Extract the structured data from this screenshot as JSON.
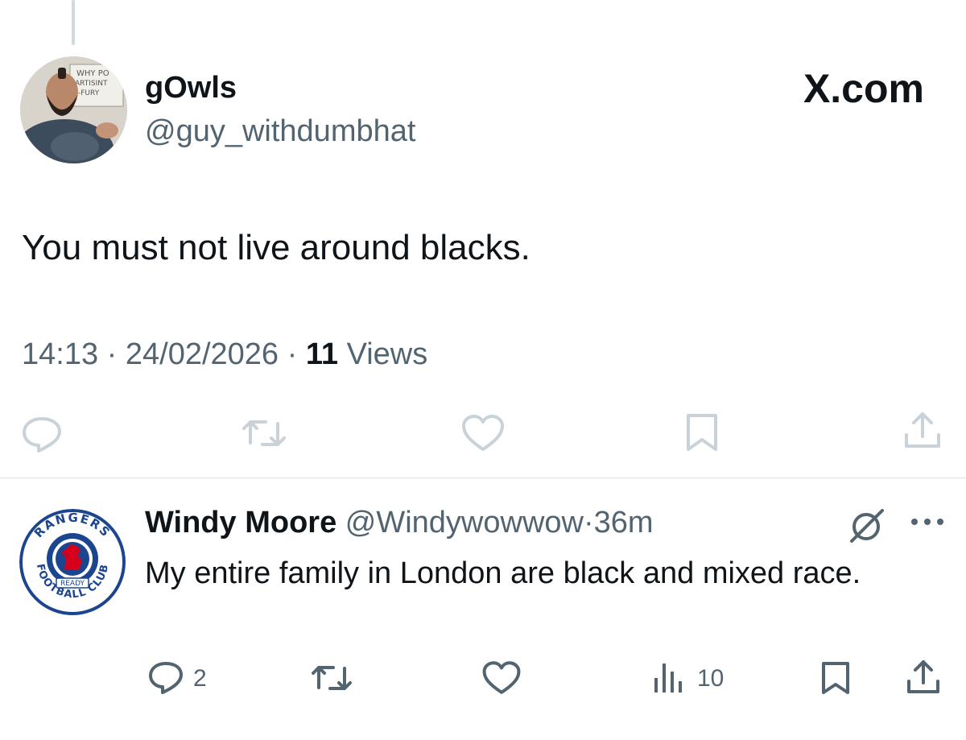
{
  "tweet": {
    "author_name": "gOwls",
    "author_handle": "@guy_withdumbhat",
    "brand": "X.com",
    "text": "You must not live around blacks.",
    "time": "14:13",
    "separator": " · ",
    "date": "24/02/2026",
    "views_count": "11",
    "views_label": " Views",
    "avatar_sign_text": [
      "WHY PO",
      "ARTISINT",
      "-FURY"
    ],
    "icons": [
      "reply-icon",
      "retweet-icon",
      "like-icon",
      "bookmark-icon",
      "share-icon"
    ]
  },
  "reply": {
    "author_name": "Windy Moore",
    "author_handle": "@Windywowwow",
    "separator": "·",
    "time": "36m",
    "text": "My entire family in London are black and mixed race.",
    "reply_count": "2",
    "views_count": "10",
    "avatar_badge_text": [
      "RANGERS",
      "FOOTBALL CLUB",
      "READY"
    ],
    "icons": [
      "mute-icon",
      "more-icon",
      "reply-icon",
      "retweet-icon",
      "like-icon",
      "views-icon",
      "bookmark-icon",
      "share-icon"
    ]
  },
  "colors": {
    "text_primary": "#0f1419",
    "text_secondary": "#536471",
    "faded_icon": "#c9d2d8",
    "rangers_blue": "#1b458f",
    "rangers_red": "#d6001c"
  }
}
